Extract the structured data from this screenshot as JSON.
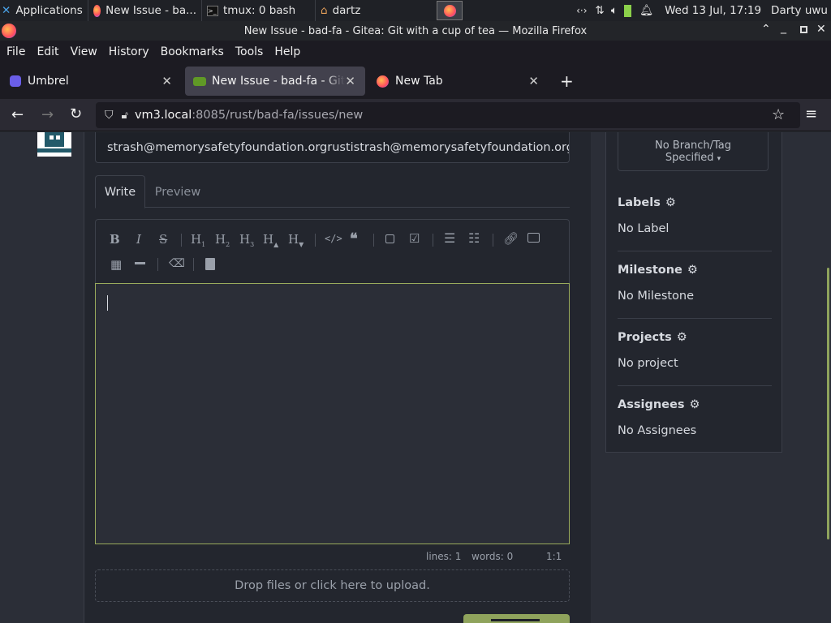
{
  "taskbar": {
    "applications": "Applications",
    "window1": "New Issue - ba...",
    "window2": "tmux: 0 bash",
    "window3": "dartz",
    "clock": "Wed 13 Jul, 17:19",
    "user": "Darty uwu"
  },
  "window": {
    "title": "New Issue - bad-fa - Gitea: Git with a cup of tea — Mozilla Firefox"
  },
  "menu": {
    "file": "File",
    "edit": "Edit",
    "view": "View",
    "history": "History",
    "bookmarks": "Bookmarks",
    "tools": "Tools",
    "help": "Help"
  },
  "tabs": {
    "tab1": "Umbrel",
    "tab2": "New Issue - bad-fa - Gitea",
    "tab3": "New Tab"
  },
  "url": {
    "host": "vm3.local",
    "rest": ":8085/rust/bad-fa/issues/new"
  },
  "issue": {
    "title_value": "strash@memorysafetyfoundation.orgrustistrash@memorysafetyfoundation.org",
    "write_tab": "Write",
    "preview_tab": "Preview",
    "status_lines": "lines: 1",
    "status_words": "words: 0",
    "status_pos": "1:1",
    "dropzone": "Drop files or click here to upload."
  },
  "sidebar": {
    "branch_line1": "No Branch/Tag",
    "branch_line2": "Specified",
    "labels_h": "Labels",
    "labels_v": "No Label",
    "milestone_h": "Milestone",
    "milestone_v": "No Milestone",
    "projects_h": "Projects",
    "projects_v": "No project",
    "assignees_h": "Assignees",
    "assignees_v": "No Assignees"
  },
  "colors": {
    "accent_green": "#8fa35c",
    "bg": "#2b2e37"
  }
}
